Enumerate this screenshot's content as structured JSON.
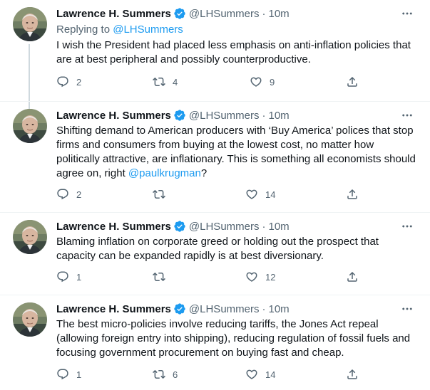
{
  "colors": {
    "link": "#1d9bf0",
    "muted": "#536471",
    "text": "#0f1419",
    "verified": "#1d9bf0"
  },
  "tweets": [
    {
      "name": "Lawrence H. Summers",
      "handle": "@LHSummers",
      "dot": "·",
      "time": "10m",
      "replying_prefix": "Replying to ",
      "replying_to": "@LHSummers",
      "text": "I wish the President had placed less emphasis on anti-inflation policies that are at best peripheral and possibly counterproductive.",
      "replies": "2",
      "retweets": "4",
      "likes": "9"
    },
    {
      "name": "Lawrence H. Summers",
      "handle": "@LHSummers",
      "dot": "·",
      "time": "10m",
      "text_before": "Shifting demand to American producers with ‘Buy America’ polices that stop firms and consumers from buying at the lowest cost, no matter how politically attractive, are inflationary. This is something all economists should agree on, right ",
      "mention": "@paulkrugman",
      "text_after": "?",
      "replies": "2",
      "retweets": "",
      "likes": "14"
    },
    {
      "name": "Lawrence H. Summers",
      "handle": "@LHSummers",
      "dot": "·",
      "time": "10m",
      "text": "Blaming inflation on corporate greed or holding out the prospect that capacity can be expanded rapidly is at best diversionary.",
      "replies": "1",
      "retweets": "",
      "likes": "12"
    },
    {
      "name": "Lawrence H. Summers",
      "handle": "@LHSummers",
      "dot": "·",
      "time": "10m",
      "text": "The best micro-policies involve reducing tariffs, the Jones Act repeal (allowing foreign entry into shipping), reducing regulation of fossil fuels and focusing government procurement on buying fast and cheap.",
      "replies": "1",
      "retweets": "6",
      "likes": "14"
    }
  ],
  "icons": {
    "reply": "reply-icon",
    "retweet": "retweet-icon",
    "like": "heart-icon",
    "share": "share-icon",
    "more": "more-icon",
    "verified": "verified-badge-icon"
  }
}
